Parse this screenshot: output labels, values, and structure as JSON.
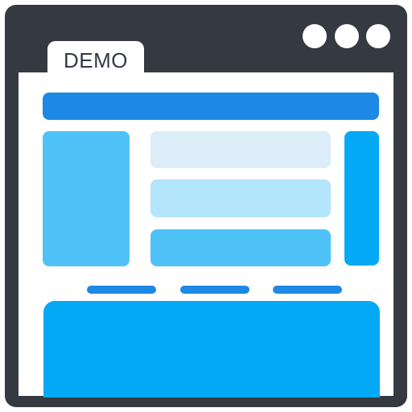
{
  "tab": {
    "label": "DEMO"
  },
  "colors": {
    "frame": "#353a42",
    "window_dots": "#ffffff",
    "tab_background": "#ffffff",
    "tab_text": "#353a42",
    "content_background": "#ffffff",
    "header_bar": "#1e88e5",
    "left_panel": "#4fc3f7",
    "row_1": "#dcedf8",
    "row_2": "#b3e5fc",
    "row_3": "#4fc3f7",
    "right_panel": "#03a9f4",
    "nav_links": "#1e88e5",
    "footer_panel": "#03a9f4"
  },
  "icons": {
    "window_controls": [
      "window-dot-icon",
      "window-dot-icon",
      "window-dot-icon"
    ]
  }
}
